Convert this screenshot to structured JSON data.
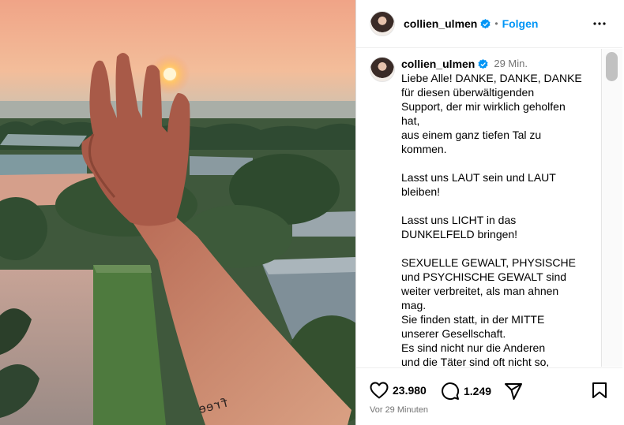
{
  "post": {
    "username": "collien_ulmen",
    "follow_label": "Folgen",
    "separator": "•",
    "caption_username": "collien_ulmen",
    "caption_time": "29 Min.",
    "caption_text": "Liebe Alle! DANKE, DANKE, DANKE\nfür diesen überwältigenden\nSupport, der mir wirklich geholfen\nhat,\naus einem ganz tiefen Tal zu\nkommen.\n\nLasst uns LAUT sein und LAUT\nbleiben!\n\nLasst uns LICHT in das\nDUNKELFELD bringen!\n\nSEXUELLE GEWALT, PHYSISCHE\nund PSYCHISCHE GEWALT sind\nweiter verbreitet, als man ahnen\nmag.\nSie finden statt, in der MITTE\nunserer Gesellschaft.\nEs sind nicht nur die Anderen\nund die Täter sind oft nicht so,",
    "likes": "23.980",
    "comments_count": "1.249",
    "timestamp": "Vor 29 Minuten",
    "tattoo_text": "free"
  },
  "icons": {
    "verified": "verified-badge-icon",
    "more": "more-options-icon",
    "like": "heart-icon",
    "comment": "comment-bubble-icon",
    "share": "paper-plane-icon",
    "save": "bookmark-icon"
  },
  "colors": {
    "accent": "#0095f6",
    "muted": "#737373",
    "sunset": "#f4b795"
  }
}
